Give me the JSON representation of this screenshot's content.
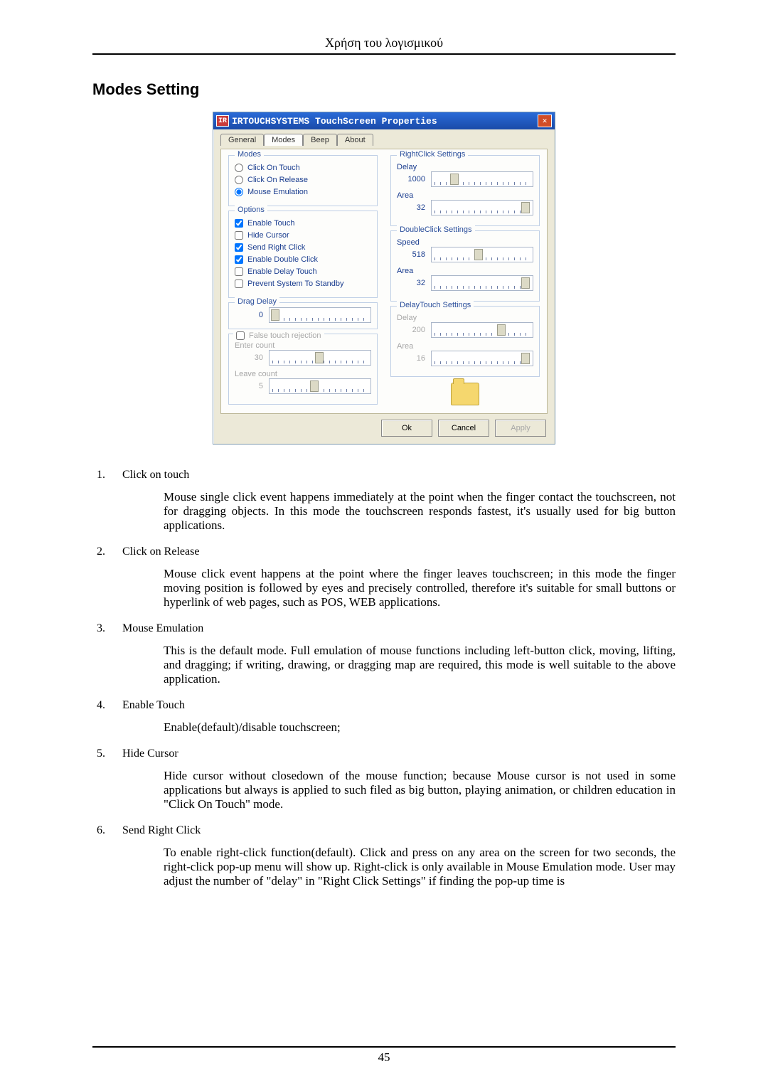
{
  "header": {
    "running_head": "Χρήση του λογισμικού",
    "page_number": "45"
  },
  "section": {
    "title": "Modes Setting"
  },
  "dialog": {
    "title": "IRTOUCHSYSTEMS TouchScreen Properties",
    "icon_text": "IR",
    "tabs": [
      "General",
      "Modes",
      "Beep",
      "About"
    ],
    "active_tab_index": 1,
    "modes": {
      "legend": "Modes",
      "options": [
        "Click On Touch",
        "Click On Release",
        "Mouse Emulation"
      ],
      "selected_index": 2
    },
    "options": {
      "legend": "Options",
      "items": [
        {
          "label": "Enable Touch",
          "checked": true
        },
        {
          "label": "Hide Cursor",
          "checked": false
        },
        {
          "label": "Send Right Click",
          "checked": true
        },
        {
          "label": "Enable Double Click",
          "checked": true
        },
        {
          "label": "Enable Delay Touch",
          "checked": false
        },
        {
          "label": "Prevent System To Standby",
          "checked": false
        }
      ]
    },
    "drag_delay": {
      "legend": "Drag Delay",
      "value": "0"
    },
    "false_touch": {
      "legend": "False touch rejection",
      "checked": false,
      "enter_label": "Enter count",
      "enter_value": "30",
      "leave_label": "Leave count",
      "leave_value": "5"
    },
    "rightclick": {
      "legend": "RightClick Settings",
      "delay_label": "Delay",
      "delay_value": "1000",
      "area_label": "Area",
      "area_value": "32"
    },
    "doubleclick": {
      "legend": "DoubleClick Settings",
      "speed_label": "Speed",
      "speed_value": "518",
      "area_label": "Area",
      "area_value": "32"
    },
    "delaytouch": {
      "legend": "DelayTouch Settings",
      "delay_label": "Delay",
      "delay_value": "200",
      "area_label": "Area",
      "area_value": "16"
    },
    "buttons": {
      "ok": "Ok",
      "cancel": "Cancel",
      "apply": "Apply"
    }
  },
  "items": [
    {
      "num": "1.",
      "title": "Click on touch",
      "body": "Mouse single click event happens immediately at the point when the finger contact the touchscreen, not for dragging objects. In this mode the touchscreen responds fastest, it's usually used for big button applications."
    },
    {
      "num": "2.",
      "title": "Click on Release",
      "body": "Mouse click event happens at the point where the finger leaves touchscreen; in this mode the finger moving position is followed by eyes and precisely controlled, therefore it's suitable for small buttons or hyperlink of web pages, such as POS, WEB applications."
    },
    {
      "num": "3.",
      "title": "Mouse Emulation",
      "body": "This is the default mode. Full emulation of mouse functions including left-button click, moving, lifting, and dragging; if writing, drawing, or dragging map are required, this mode is well suitable to the above application."
    },
    {
      "num": "4.",
      "title": "Enable Touch",
      "body": "Enable(default)/disable touchscreen;"
    },
    {
      "num": "5.",
      "title": "Hide Cursor",
      "body": "Hide cursor without closedown of the mouse function; because Mouse cursor is not used in some applications but always is applied to such filed as big button, playing animation, or children education in \"Click On Touch\" mode."
    },
    {
      "num": "6.",
      "title": "Send Right Click",
      "body": "To enable right-click function(default). Click and press on any area on the screen for two seconds, the right-click pop-up menu will show up. Right-click is only available in Mouse Emulation mode. User may adjust the number of \"delay\" in \"Right Click Settings\" if finding the pop-up time is"
    }
  ]
}
